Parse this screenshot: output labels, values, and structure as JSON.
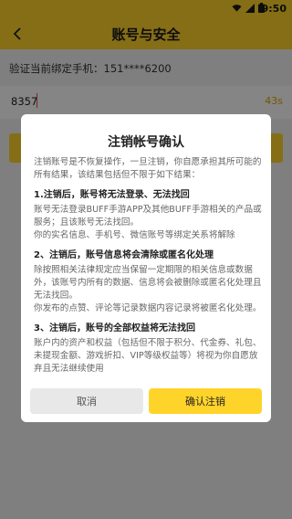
{
  "status_bar": {
    "time": "9:50"
  },
  "app_bar": {
    "title": "账号与安全"
  },
  "page": {
    "phone_label": "验证当前绑定手机：151****6200",
    "code_value": "8357",
    "countdown": "43s"
  },
  "dialog": {
    "title": "注销帐号确认",
    "intro": "注销账号是不恢复操作，一旦注销，你自愿承担其所可能的所有结果，该结果包括但不限于如下结果：",
    "sections": [
      {
        "heading": "1.注销后，账号将无法登录、无法找回",
        "paragraphs": [
          "账号无法登录BUFF手游APP及其他BUFF手游相关的产品或服务；且该账号无法找回。",
          "你的实名信息、手机号、微信账号等绑定关系将解除"
        ]
      },
      {
        "heading": "2、注销后，账号信息将会清除或匿名化处理",
        "paragraphs": [
          "除按照相关法律规定应当保留一定期限的相关信息或数据外，该账号内所有的数据、信息将会被删除或匿名化处理且无法找回。",
          "你发布的点赞、评论等记录数据内容记录将被匿名化处理。"
        ]
      },
      {
        "heading": "3、注销后，账号的全部权益将无法找回",
        "paragraphs": [
          "账户内的资产和权益（包括但不限于积分、代金券、礼包、未提现金额、游戏折扣、VIP等级权益等）将视为你自愿放弃且无法继续使用"
        ]
      }
    ],
    "cancel_label": "取消",
    "confirm_label": "确认注销"
  }
}
